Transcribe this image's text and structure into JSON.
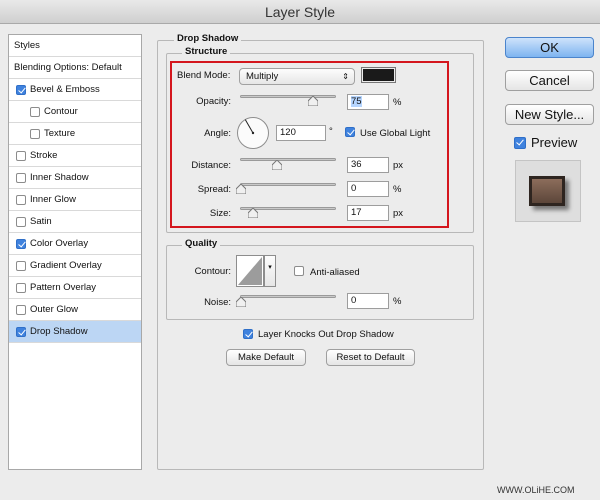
{
  "window": {
    "title": "Layer Style"
  },
  "sidebar": {
    "items": [
      {
        "label": "Styles",
        "checkbox": false,
        "checked": false,
        "selected": false
      },
      {
        "label": "Blending Options: Default",
        "checkbox": false,
        "checked": false,
        "selected": false
      },
      {
        "label": "Bevel & Emboss",
        "checkbox": true,
        "checked": true,
        "selected": false
      },
      {
        "label": "Contour",
        "checkbox": true,
        "checked": false,
        "selected": false,
        "indent": true
      },
      {
        "label": "Texture",
        "checkbox": true,
        "checked": false,
        "selected": false,
        "indent": true
      },
      {
        "label": "Stroke",
        "checkbox": true,
        "checked": false,
        "selected": false
      },
      {
        "label": "Inner Shadow",
        "checkbox": true,
        "checked": false,
        "selected": false
      },
      {
        "label": "Inner Glow",
        "checkbox": true,
        "checked": false,
        "selected": false
      },
      {
        "label": "Satin",
        "checkbox": true,
        "checked": false,
        "selected": false
      },
      {
        "label": "Color Overlay",
        "checkbox": true,
        "checked": true,
        "selected": false
      },
      {
        "label": "Gradient Overlay",
        "checkbox": true,
        "checked": false,
        "selected": false
      },
      {
        "label": "Pattern Overlay",
        "checkbox": true,
        "checked": false,
        "selected": false
      },
      {
        "label": "Outer Glow",
        "checkbox": true,
        "checked": false,
        "selected": false
      },
      {
        "label": "Drop Shadow",
        "checkbox": true,
        "checked": true,
        "selected": true
      }
    ]
  },
  "panel": {
    "title": "Drop Shadow",
    "structure": {
      "legend": "Structure",
      "blend_mode_label": "Blend Mode:",
      "blend_mode_value": "Multiply",
      "shadow_color": "#1a1a1a",
      "opacity_label": "Opacity:",
      "opacity_value": "75",
      "opacity_unit": "%",
      "angle_label": "Angle:",
      "angle_value": "120",
      "angle_unit": "°",
      "use_global_light_label": "Use Global Light",
      "use_global_light_checked": true,
      "distance_label": "Distance:",
      "distance_value": "36",
      "distance_unit": "px",
      "spread_label": "Spread:",
      "spread_value": "0",
      "spread_unit": "%",
      "size_label": "Size:",
      "size_value": "17",
      "size_unit": "px"
    },
    "quality": {
      "legend": "Quality",
      "contour_label": "Contour:",
      "anti_aliased_label": "Anti-aliased",
      "anti_aliased_checked": false,
      "noise_label": "Noise:",
      "noise_value": "0",
      "noise_unit": "%"
    },
    "knockout_label": "Layer Knocks Out Drop Shadow",
    "knockout_checked": true,
    "make_default_label": "Make Default",
    "reset_default_label": "Reset to Default"
  },
  "buttons": {
    "ok_label": "OK",
    "cancel_label": "Cancel",
    "new_style_label": "New Style...",
    "preview_label": "Preview",
    "preview_checked": true
  },
  "watermark": "WWW.OLiHE.COM",
  "colors": {
    "accent": "#3f82de",
    "highlight_box": "#d4161d",
    "selection": "#bcd6f4"
  }
}
